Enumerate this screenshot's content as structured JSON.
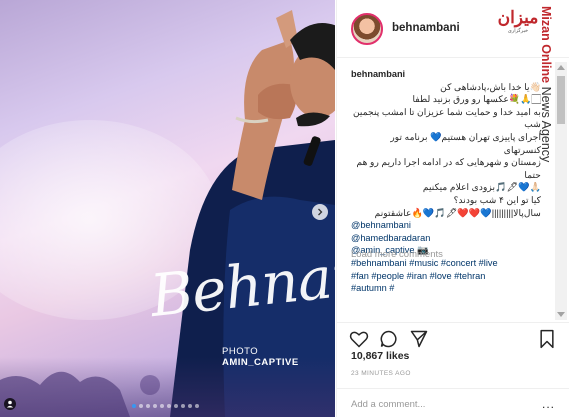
{
  "post": {
    "username": "behnambani",
    "watermark_brand": "میزان",
    "watermark_tag": "خبرگزاری",
    "side_brand_red": "Mizan Online",
    "side_brand_grey": " News Agency",
    "photo_signature": "Behnam",
    "photo_credit_prefix": "PHOTO ",
    "photo_credit_name": "AMIN_CAPTIVE",
    "caption_lines": [
      "👋🏻یا خدا باش،پادشاهی کن",
      "🏻🙏💐عکسها رو ورق بزنید لطفا",
      "به امید خدا و حمایت شما عزیزان تا امشب پنجمین شب",
      "اجرای پاییزی تهران هستیم💙 برنامه تور کنسرتهای",
      "زمستان و شهرهایی که در ادامه اجرا داریم رو هم حتما",
      "🙏🏻💙🖋🎵بزودی اعلام میکنیم",
      "کیا تو این ۴ شب بودند؟",
      "سال‌پالا|||||||||💙❤️❤️🖋🎵💙🔥عاشقتونم"
    ],
    "mentions": [
      "@behnambani",
      "@hamedbaradaran",
      "@amin_captive 📷"
    ],
    "hashtags": [
      "#behnambani #music #concert #live",
      "#fan #people #iran #love #tehran",
      "#autumn #"
    ],
    "load_more": "Load more comments",
    "likes": "10,867 likes",
    "time": "23 MINUTES AGO",
    "comment_placeholder": "Add a comment...",
    "more_label": "...",
    "carousel": {
      "total": 10,
      "active": 0
    },
    "colors": {
      "accent": "#3897f0",
      "brand_red": "#c0282d",
      "text": "#262626",
      "muted": "#999999"
    },
    "icons": [
      "heart-icon",
      "comment-icon",
      "share-icon",
      "bookmark-icon",
      "chevron-right-icon"
    ]
  }
}
